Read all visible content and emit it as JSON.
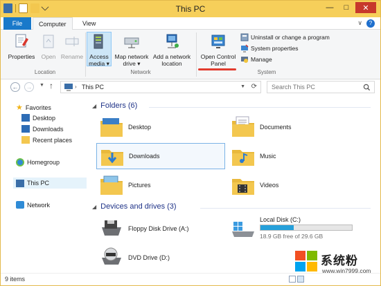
{
  "window": {
    "title": "This PC"
  },
  "titlebar": {
    "minimize": "—",
    "maximize": "□",
    "close": "✕"
  },
  "ribbon_tabs": {
    "file": "File",
    "computer": "Computer",
    "view": "View",
    "help": "?"
  },
  "ribbon": {
    "location": {
      "label": "Location",
      "properties": "Properties",
      "open": "Open",
      "rename": "Rename"
    },
    "network": {
      "label": "Network",
      "access_media": "Access media ▾",
      "map_network_drive": "Map network drive ▾",
      "add_network_location": "Add a network location"
    },
    "system": {
      "label": "System",
      "open_control_panel": "Open Control Panel",
      "uninstall": "Uninstall or change a program",
      "system_properties": "System properties",
      "manage": "Manage"
    }
  },
  "address": {
    "path": "This PC",
    "search_placeholder": "Search This PC"
  },
  "nav": {
    "favorites": "Favorites",
    "desktop": "Desktop",
    "downloads": "Downloads",
    "recent": "Recent places",
    "homegroup": "Homegroup",
    "thispc": "This PC",
    "network": "Network"
  },
  "content": {
    "folders_header": "Folders (6)",
    "folders": [
      "Desktop",
      "Documents",
      "Downloads",
      "Music",
      "Pictures",
      "Videos"
    ],
    "devices_header": "Devices and drives (3)",
    "drives": [
      {
        "name": "Floppy Disk Drive (A:)"
      },
      {
        "name": "Local Disk (C:)",
        "info": "18.9 GB free of 29.6 GB",
        "used_fraction": 0.36
      },
      {
        "name": "DVD Drive (D:)"
      }
    ]
  },
  "status": {
    "count": "9 items"
  },
  "watermark": {
    "text": "系统粉",
    "url": "www.win7999.com"
  },
  "colors": {
    "titlebar": "#f6cf5a",
    "accent": "#1979ca",
    "folder": "#f3c74f",
    "drive_fill": "#26a0da",
    "annotation": "#e23b2e"
  }
}
